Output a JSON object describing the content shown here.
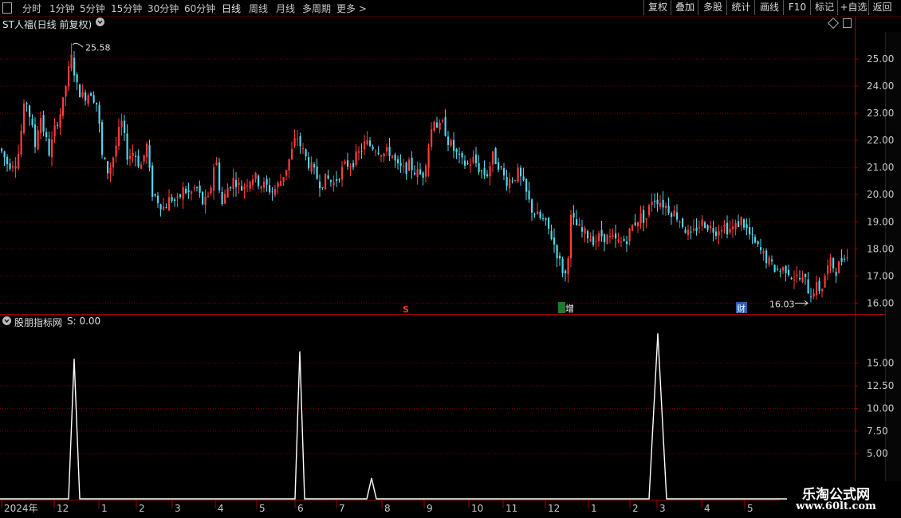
{
  "toolbar": {
    "periods": [
      "分时",
      "1分钟",
      "5分钟",
      "15分钟",
      "30分钟",
      "60分钟",
      "日线",
      "周线",
      "月线",
      "多周期",
      "更多 >"
    ],
    "active_period": "日线",
    "buttons": [
      "复权",
      "叠加",
      "多股",
      "统计",
      "画线",
      "F10",
      "标记",
      "+自选",
      "返回"
    ]
  },
  "stock": {
    "title": "ST人福(日线 前复权)"
  },
  "indicator": {
    "title": "股朋指标网",
    "value_label": "S: 0.00"
  },
  "colors": {
    "up": "#ff3b3b",
    "down": "#52d4e8",
    "grid": "#7a0000",
    "separator": "#a00000",
    "line": "#ffffff"
  },
  "chart_data": [
    {
      "type": "candlestick",
      "title": "ST人福(日线 前复权)",
      "ylim": [
        15.6,
        26.0
      ],
      "y_ticks": [
        16.0,
        17.0,
        18.0,
        19.0,
        20.0,
        21.0,
        22.0,
        23.0,
        24.0,
        25.0
      ],
      "y_tick_labels": [
        "16.00",
        "17.00",
        "18.00",
        "19.00",
        "20.00",
        "21.00",
        "22.00",
        "23.00",
        "24.00",
        "25.00"
      ],
      "annotations": [
        {
          "text": "25.58",
          "kind": "high",
          "value": 25.58
        },
        {
          "text": "16.03",
          "kind": "low",
          "value": 16.03
        }
      ],
      "event_markers": [
        {
          "text": "S",
          "color": "#ff3333"
        },
        {
          "text": "增",
          "color": "#ffffff",
          "badge": "#1e7a2e"
        },
        {
          "text": "财",
          "color": "#ffffff",
          "badge": "#2b5fa8"
        }
      ],
      "trend": [
        {
          "x": 0,
          "close": 21.7
        },
        {
          "x": 10,
          "close": 21.1
        },
        {
          "x": 22,
          "close": 21.3
        },
        {
          "x": 32,
          "close": 23.6
        },
        {
          "x": 38,
          "close": 22.8
        },
        {
          "x": 44,
          "close": 21.8
        },
        {
          "x": 50,
          "close": 23.0
        },
        {
          "x": 56,
          "close": 22.2
        },
        {
          "x": 62,
          "close": 21.5
        },
        {
          "x": 70,
          "close": 22.6
        },
        {
          "x": 78,
          "close": 23.2
        },
        {
          "x": 84,
          "close": 24.3
        },
        {
          "x": 90,
          "close": 25.1
        },
        {
          "x": 96,
          "close": 24.0
        },
        {
          "x": 104,
          "close": 23.6
        },
        {
          "x": 114,
          "close": 23.8
        },
        {
          "x": 122,
          "close": 23.3
        },
        {
          "x": 128,
          "close": 21.4
        },
        {
          "x": 136,
          "close": 20.8
        },
        {
          "x": 144,
          "close": 21.6
        },
        {
          "x": 152,
          "close": 22.7
        },
        {
          "x": 160,
          "close": 21.4
        },
        {
          "x": 168,
          "close": 21.6
        },
        {
          "x": 176,
          "close": 21.0
        },
        {
          "x": 184,
          "close": 21.8
        },
        {
          "x": 190,
          "close": 20.1
        },
        {
          "x": 198,
          "close": 19.8
        },
        {
          "x": 206,
          "close": 19.5
        },
        {
          "x": 214,
          "close": 19.9
        },
        {
          "x": 222,
          "close": 19.7
        },
        {
          "x": 230,
          "close": 20.2
        },
        {
          "x": 238,
          "close": 20.0
        },
        {
          "x": 246,
          "close": 20.3
        },
        {
          "x": 254,
          "close": 19.7
        },
        {
          "x": 262,
          "close": 19.8
        },
        {
          "x": 270,
          "close": 21.5
        },
        {
          "x": 278,
          "close": 19.6
        },
        {
          "x": 286,
          "close": 20.3
        },
        {
          "x": 294,
          "close": 20.6
        },
        {
          "x": 302,
          "close": 20.2
        },
        {
          "x": 310,
          "close": 20.5
        },
        {
          "x": 318,
          "close": 20.7
        },
        {
          "x": 326,
          "close": 20.4
        },
        {
          "x": 334,
          "close": 20.3
        },
        {
          "x": 342,
          "close": 20.1
        },
        {
          "x": 350,
          "close": 20.4
        },
        {
          "x": 358,
          "close": 20.9
        },
        {
          "x": 366,
          "close": 21.6
        },
        {
          "x": 372,
          "close": 22.2
        },
        {
          "x": 378,
          "close": 21.7
        },
        {
          "x": 386,
          "close": 21.2
        },
        {
          "x": 394,
          "close": 20.8
        },
        {
          "x": 402,
          "close": 20.4
        },
        {
          "x": 410,
          "close": 20.6
        },
        {
          "x": 418,
          "close": 20.4
        },
        {
          "x": 426,
          "close": 20.8
        },
        {
          "x": 434,
          "close": 21.1
        },
        {
          "x": 442,
          "close": 21.2
        },
        {
          "x": 450,
          "close": 21.5
        },
        {
          "x": 458,
          "close": 21.9
        },
        {
          "x": 466,
          "close": 21.8
        },
        {
          "x": 474,
          "close": 21.7
        },
        {
          "x": 482,
          "close": 21.5
        },
        {
          "x": 490,
          "close": 21.6
        },
        {
          "x": 498,
          "close": 21.0
        },
        {
          "x": 506,
          "close": 20.9
        },
        {
          "x": 514,
          "close": 21.1
        },
        {
          "x": 522,
          "close": 20.8
        },
        {
          "x": 530,
          "close": 20.7
        },
        {
          "x": 538,
          "close": 21.9
        },
        {
          "x": 544,
          "close": 22.9
        },
        {
          "x": 550,
          "close": 22.4
        },
        {
          "x": 556,
          "close": 22.6
        },
        {
          "x": 562,
          "close": 22.0
        },
        {
          "x": 570,
          "close": 21.6
        },
        {
          "x": 578,
          "close": 21.2
        },
        {
          "x": 586,
          "close": 21.1
        },
        {
          "x": 594,
          "close": 21.3
        },
        {
          "x": 602,
          "close": 20.9
        },
        {
          "x": 610,
          "close": 20.7
        },
        {
          "x": 618,
          "close": 21.4
        },
        {
          "x": 626,
          "close": 21.1
        },
        {
          "x": 634,
          "close": 20.5
        },
        {
          "x": 642,
          "close": 20.6
        },
        {
          "x": 650,
          "close": 20.8
        },
        {
          "x": 658,
          "close": 20.2
        },
        {
          "x": 666,
          "close": 19.5
        },
        {
          "x": 674,
          "close": 19.2
        },
        {
          "x": 682,
          "close": 19.0
        },
        {
          "x": 690,
          "close": 18.6
        },
        {
          "x": 698,
          "close": 17.9
        },
        {
          "x": 704,
          "close": 17.3
        },
        {
          "x": 710,
          "close": 17.0
        },
        {
          "x": 716,
          "close": 19.1
        },
        {
          "x": 722,
          "close": 18.9
        },
        {
          "x": 730,
          "close": 18.6
        },
        {
          "x": 738,
          "close": 18.5
        },
        {
          "x": 746,
          "close": 18.3
        },
        {
          "x": 754,
          "close": 18.5
        },
        {
          "x": 762,
          "close": 18.4
        },
        {
          "x": 770,
          "close": 18.3
        },
        {
          "x": 778,
          "close": 18.2
        },
        {
          "x": 786,
          "close": 18.4
        },
        {
          "x": 794,
          "close": 18.9
        },
        {
          "x": 802,
          "close": 19.2
        },
        {
          "x": 810,
          "close": 19.1
        },
        {
          "x": 818,
          "close": 19.9
        },
        {
          "x": 826,
          "close": 19.8
        },
        {
          "x": 834,
          "close": 19.6
        },
        {
          "x": 842,
          "close": 19.4
        },
        {
          "x": 850,
          "close": 19.2
        },
        {
          "x": 858,
          "close": 18.8
        },
        {
          "x": 866,
          "close": 18.4
        },
        {
          "x": 874,
          "close": 18.8
        },
        {
          "x": 882,
          "close": 19.0
        },
        {
          "x": 890,
          "close": 18.8
        },
        {
          "x": 898,
          "close": 18.7
        },
        {
          "x": 906,
          "close": 18.9
        },
        {
          "x": 914,
          "close": 18.7
        },
        {
          "x": 922,
          "close": 18.8
        },
        {
          "x": 930,
          "close": 19.1
        },
        {
          "x": 938,
          "close": 18.6
        },
        {
          "x": 946,
          "close": 18.2
        },
        {
          "x": 954,
          "close": 17.9
        },
        {
          "x": 962,
          "close": 17.6
        },
        {
          "x": 970,
          "close": 17.3
        },
        {
          "x": 978,
          "close": 17.2
        },
        {
          "x": 986,
          "close": 17.3
        },
        {
          "x": 994,
          "close": 17.0
        },
        {
          "x": 1002,
          "close": 16.9
        },
        {
          "x": 1010,
          "close": 16.8
        },
        {
          "x": 1016,
          "close": 16.3
        },
        {
          "x": 1022,
          "close": 16.6
        },
        {
          "x": 1030,
          "close": 16.5
        },
        {
          "x": 1036,
          "close": 17.2
        },
        {
          "x": 1042,
          "close": 17.5
        },
        {
          "x": 1048,
          "close": 17.2
        },
        {
          "x": 1054,
          "close": 17.5
        },
        {
          "x": 1060,
          "close": 17.9
        },
        {
          "x": 1066,
          "close": 17.4
        }
      ]
    },
    {
      "type": "line",
      "name": "S",
      "ylim": [
        0,
        18.5
      ],
      "y_ticks": [
        5.0,
        7.5,
        10.0,
        12.5,
        15.0
      ],
      "y_tick_labels": [
        "5.00",
        "7.50",
        "10.00",
        "12.50",
        "15.00"
      ],
      "x": [
        0,
        86,
        93,
        100,
        370,
        376,
        382,
        460,
        466,
        472,
        814,
        825,
        836,
        1072
      ],
      "y": [
        0,
        0,
        15.5,
        0,
        0,
        16.3,
        0,
        0,
        2.3,
        0,
        0,
        18.3,
        0,
        0
      ]
    },
    {
      "type": "axis",
      "x_tick_labels": [
        {
          "label": "2024年",
          "x": 2
        },
        {
          "label": "12",
          "x": 68
        },
        {
          "label": "1",
          "x": 124
        },
        {
          "label": "2",
          "x": 171
        },
        {
          "label": "3",
          "x": 216
        },
        {
          "label": "4",
          "x": 270
        },
        {
          "label": "5",
          "x": 322
        },
        {
          "label": "6",
          "x": 370
        },
        {
          "label": "7",
          "x": 422
        },
        {
          "label": "8",
          "x": 479
        },
        {
          "label": "9",
          "x": 532
        },
        {
          "label": "10",
          "x": 588
        },
        {
          "label": "11",
          "x": 631
        },
        {
          "label": "12",
          "x": 684
        },
        {
          "label": "1",
          "x": 738
        },
        {
          "label": "2",
          "x": 790
        },
        {
          "label": "3",
          "x": 824
        },
        {
          "label": "4",
          "x": 880
        },
        {
          "label": "5",
          "x": 934
        }
      ]
    }
  ],
  "watermark": {
    "title": "乐淘公式网",
    "url": "www.60lt.com"
  }
}
